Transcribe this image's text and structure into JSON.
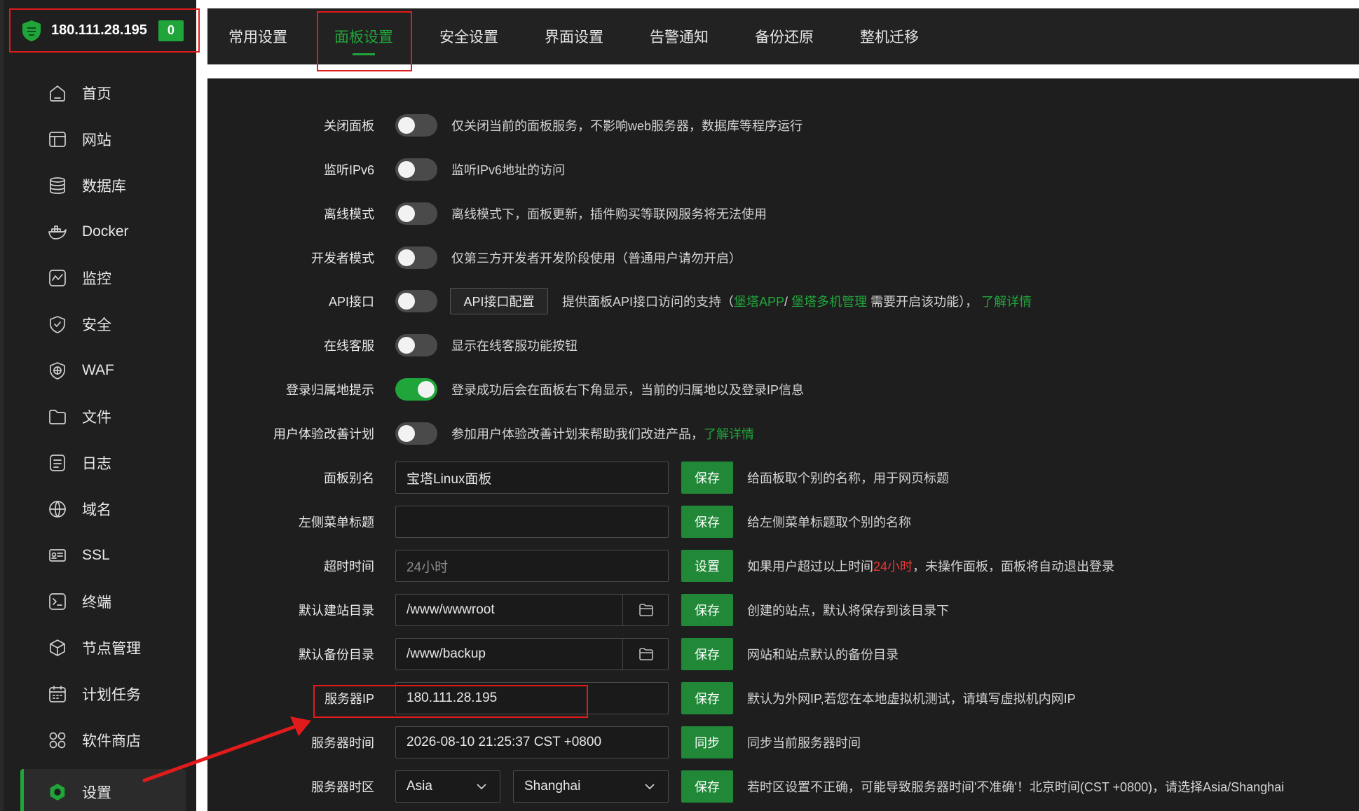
{
  "server": {
    "ip": "180.111.28.195",
    "badge": "0"
  },
  "sidebar": {
    "items": [
      {
        "label": "首页",
        "icon": "home-icon"
      },
      {
        "label": "网站",
        "icon": "website-icon"
      },
      {
        "label": "数据库",
        "icon": "database-icon"
      },
      {
        "label": "Docker",
        "icon": "docker-icon"
      },
      {
        "label": "监控",
        "icon": "monitor-icon"
      },
      {
        "label": "安全",
        "icon": "shield-icon"
      },
      {
        "label": "WAF",
        "icon": "waf-icon"
      },
      {
        "label": "文件",
        "icon": "folder-icon"
      },
      {
        "label": "日志",
        "icon": "log-icon"
      },
      {
        "label": "域名",
        "icon": "globe-icon"
      },
      {
        "label": "SSL",
        "icon": "certificate-icon"
      },
      {
        "label": "终端",
        "icon": "terminal-icon"
      },
      {
        "label": "节点管理",
        "icon": "cube-icon"
      },
      {
        "label": "计划任务",
        "icon": "calendar-icon"
      },
      {
        "label": "软件商店",
        "icon": "apps-icon"
      },
      {
        "label": "设置",
        "icon": "settings-icon",
        "active": true
      }
    ]
  },
  "tabs": [
    "常用设置",
    "面板设置",
    "安全设置",
    "界面设置",
    "告警通知",
    "备份还原",
    "整机迁移"
  ],
  "active_tab": "面板设置",
  "settings": {
    "close_panel": {
      "label": "关闭面板",
      "desc": "仅关闭当前的面板服务，不影响web服务器，数据库等程序运行",
      "on": false
    },
    "ipv6": {
      "label": "监听IPv6",
      "desc": "监听IPv6地址的访问",
      "on": false
    },
    "offline": {
      "label": "离线模式",
      "desc": "离线模式下，面板更新，插件购买等联网服务将无法使用",
      "on": false
    },
    "developer": {
      "label": "开发者模式",
      "desc": "仅第三方开发者开发阶段使用（普通用户请勿开启）",
      "on": false
    },
    "api": {
      "label": "API接口",
      "button": "API接口配置",
      "desc_pre": "提供面板API接口访问的支持（",
      "link1": "堡塔APP",
      "sep": "/",
      "link2": "堡塔多机管理",
      "desc_mid": "需要开启该功能），",
      "link3": "了解详情",
      "on": false
    },
    "online_service": {
      "label": "在线客服",
      "desc": "显示在线客服功能按钮",
      "on": false
    },
    "login_location": {
      "label": "登录归属地提示",
      "desc": "登录成功后会在面板右下角显示，当前的归属地以及登录IP信息",
      "on": true
    },
    "ux_plan": {
      "label": "用户体验改善计划",
      "desc": "参加用户体验改善计划来帮助我们改进产品，",
      "link": "了解详情",
      "on": false
    },
    "panel_alias": {
      "label": "面板别名",
      "value": "宝塔Linux面板",
      "button": "保存",
      "desc": "给面板取个别的名称，用于网页标题"
    },
    "menu_title": {
      "label": "左侧菜单标题",
      "value": "",
      "button": "保存",
      "desc": "给左侧菜单标题取个别的名称"
    },
    "timeout": {
      "label": "超时时间",
      "placeholder": "24小时",
      "button": "设置",
      "desc_pre": "如果用户超过以上时间",
      "desc_red": "24小时",
      "desc_post": "，未操作面板，面板将自动退出登录"
    },
    "site_dir": {
      "label": "默认建站目录",
      "value": "/www/wwwroot",
      "button": "保存",
      "desc": "创建的站点，默认将保存到该目录下"
    },
    "backup_dir": {
      "label": "默认备份目录",
      "value": "/www/backup",
      "button": "保存",
      "desc": "网站和站点默认的备份目录"
    },
    "server_ip": {
      "label": "服务器IP",
      "value": "180.111.28.195",
      "button": "保存",
      "desc": "默认为外网IP,若您在本地虚拟机测试，请填写虚拟机内网IP"
    },
    "server_time": {
      "label": "服务器时间",
      "value": "2026-08-10 21:25:37 CST +0800",
      "button": "同步",
      "desc": "同步当前服务器时间"
    },
    "timezone": {
      "label": "服务器时区",
      "region": "Asia",
      "city": "Shanghai",
      "button": "保存",
      "desc": "若时区设置不正确，可能导致服务器时间'不准确'！北京时间(CST +0800)，请选择Asia/Shanghai"
    }
  },
  "colors": {
    "accent": "#20a53a",
    "highlight": "#e11b1b",
    "panel_bg": "#1e1e1e",
    "sidebar_bg": "#1f1f1f"
  }
}
